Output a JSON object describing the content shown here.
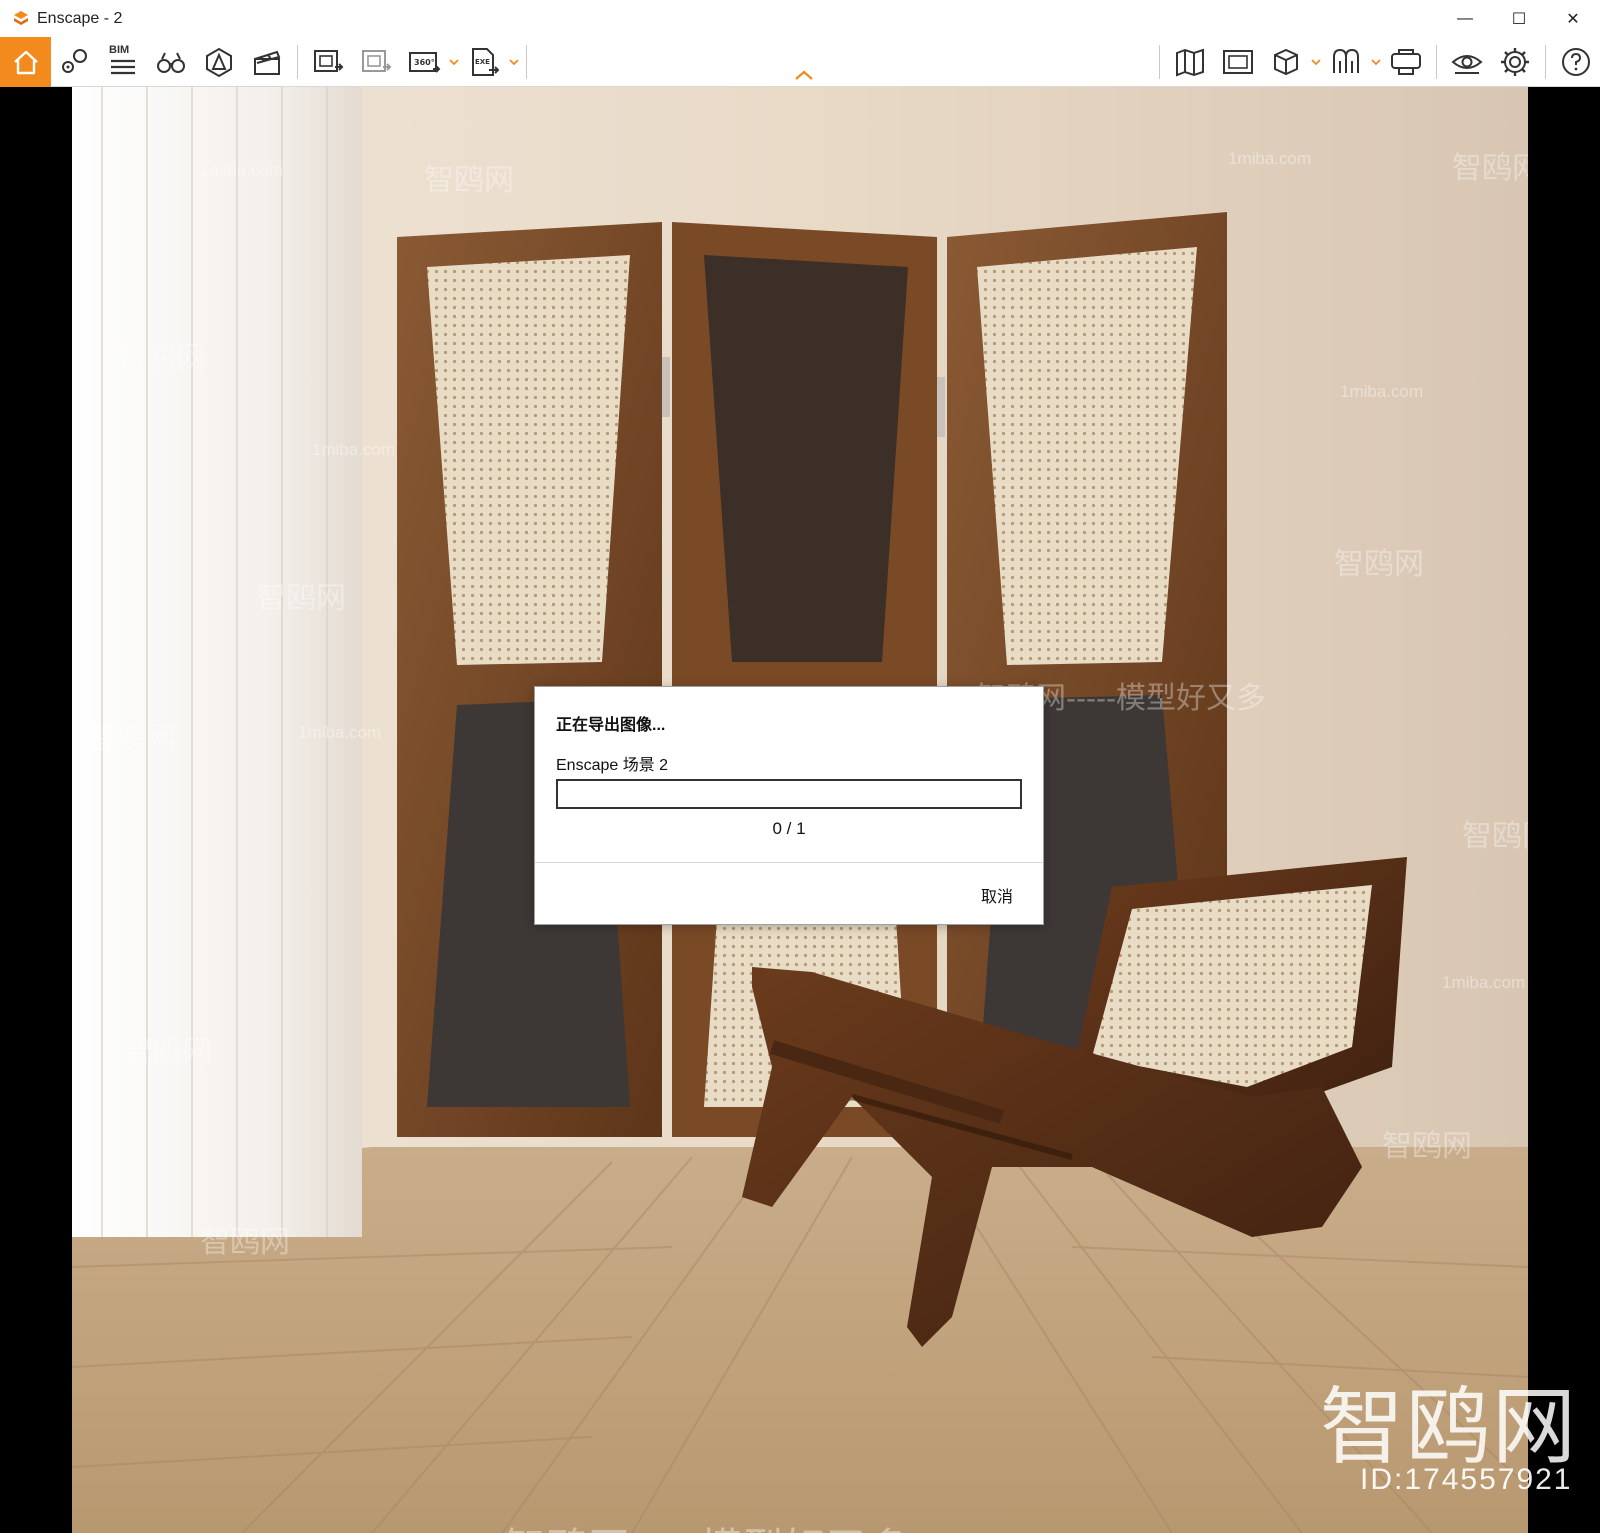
{
  "window": {
    "title": "Enscape - 2",
    "controls": {
      "minimize": "—",
      "maximize": "☐",
      "close": "✕"
    }
  },
  "toolbar": {
    "left_buttons": [
      {
        "icon": "home-icon"
      },
      {
        "icon": "location-pin-icon"
      },
      {
        "icon": "bim-list-icon",
        "label": "BIM"
      },
      {
        "icon": "binoculars-icon"
      },
      {
        "icon": "asset-library-icon"
      },
      {
        "icon": "clapperboard-icon"
      },
      {
        "icon": "batch-render-icon"
      },
      {
        "icon": "batch-export-icon"
      },
      {
        "icon": "panorama-360-icon",
        "label": "360°"
      },
      {
        "icon": "exe-export-icon",
        "label": "EXE"
      }
    ],
    "right_buttons": [
      {
        "icon": "map-icon"
      },
      {
        "icon": "upload-rendering-icon"
      },
      {
        "icon": "cube-icon"
      },
      {
        "icon": "vr-headset-icon"
      },
      {
        "icon": "screenshot-collaboration-icon"
      },
      {
        "icon": "eye-visual-settings-icon"
      },
      {
        "icon": "gear-icon"
      },
      {
        "icon": "help-icon"
      }
    ],
    "accent_color": "#f28a1e"
  },
  "dialog": {
    "title": "正在导出图像...",
    "scene_name": "Enscape 场景 2",
    "progress_fraction": 0,
    "progress_text": "0 / 1",
    "cancel_label": "取消"
  },
  "watermarks": {
    "brand": "智鸥网",
    "site": "1miba.com",
    "slogan": "智鸥网-----模型好又多----",
    "slogan2": "智鸥网-----模型好又多",
    "id": "ID:174557921"
  }
}
